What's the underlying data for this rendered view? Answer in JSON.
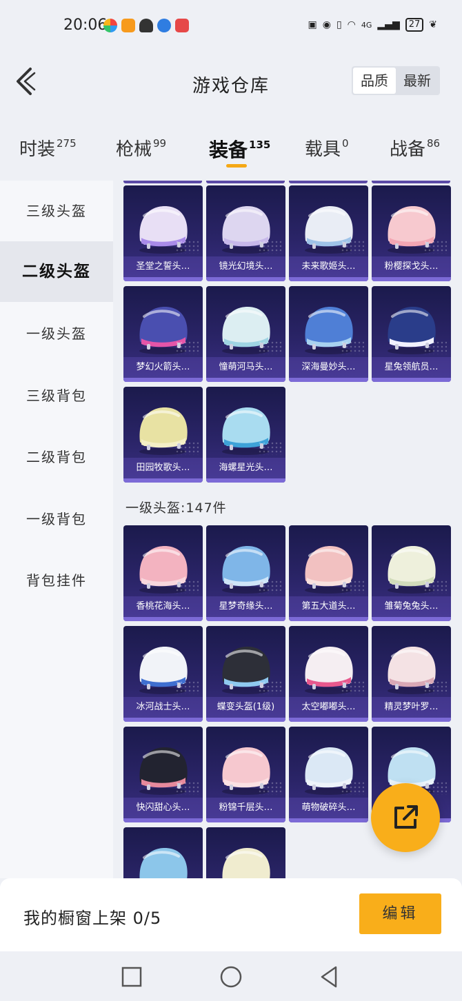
{
  "status_bar": {
    "time": "20:06",
    "network": "4G",
    "battery": "27"
  },
  "header": {
    "title": "游戏仓库",
    "sort_options": [
      "品质",
      "最新"
    ],
    "active_sort": "品质"
  },
  "tabs": [
    {
      "label": "时装",
      "count": "275"
    },
    {
      "label": "枪械",
      "count": "99"
    },
    {
      "label": "装备",
      "count": "135",
      "active": true
    },
    {
      "label": "载具",
      "count": "0"
    },
    {
      "label": "战备",
      "count": "86"
    }
  ],
  "sidebar": {
    "items": [
      "三级头盔",
      "二级头盔",
      "一级头盔",
      "三级背包",
      "二级背包",
      "一级背包",
      "背包挂件"
    ],
    "active": "二级头盔"
  },
  "level2_items": [
    {
      "name": "圣堂之誓头…",
      "color": "#e8dff5",
      "accent": "#a98be8"
    },
    {
      "name": "镜光幻境头…",
      "color": "#ddd6f0",
      "accent": "#c7b8ea"
    },
    {
      "name": "未来歌姬头…",
      "color": "#e9edf5",
      "accent": "#9fc3e8"
    },
    {
      "name": "粉樱探戈头…",
      "color": "#f7c9cf",
      "accent": "#f3a6b3"
    },
    {
      "name": "梦幻火箭头…",
      "color": "#4a4fb0",
      "accent": "#e455a8"
    },
    {
      "name": "憧萌河马头…",
      "color": "#dceef2",
      "accent": "#9fd4e3"
    },
    {
      "name": "深海曼妙头…",
      "color": "#4f7fd6",
      "accent": "#a9d2f0"
    },
    {
      "name": "星兔领航员…",
      "color": "#2a3d8a",
      "accent": "#f1f1ff"
    },
    {
      "name": "田园牧歌头…",
      "color": "#e8e2a3",
      "accent": "#f4efc6"
    },
    {
      "name": "海螺星光头…",
      "color": "#a9dcf0",
      "accent": "#3ea2d8"
    }
  ],
  "level1_section": {
    "title": "一级头盔:147件"
  },
  "level1_items": [
    {
      "name": "香桃花海头…",
      "color": "#f3b3c0",
      "accent": "#f8d7dd"
    },
    {
      "name": "星梦奇缘头…",
      "color": "#7fb6e8",
      "accent": "#cfe5f7"
    },
    {
      "name": "第五大道头…",
      "color": "#f2c1c1",
      "accent": "#f8e1de"
    },
    {
      "name": "雏菊兔兔头…",
      "color": "#eef0dc",
      "accent": "#d2dcbb"
    },
    {
      "name": "冰河战士头…",
      "color": "#f1f3f8",
      "accent": "#3f6fd0"
    },
    {
      "name": "蝶变头盔(1级)",
      "color": "#2d2f38",
      "accent": "#8fc9ef"
    },
    {
      "name": "太空嘟嘟头…",
      "color": "#f5eef2",
      "accent": "#e7588d"
    },
    {
      "name": "精灵梦叶罗…",
      "color": "#f4e2e4",
      "accent": "#d9a8b5"
    },
    {
      "name": "快闪甜心头…",
      "color": "#222330",
      "accent": "#e6899c"
    },
    {
      "name": "粉锦千层头…",
      "color": "#f6c8cf",
      "accent": "#fbe1e4"
    },
    {
      "name": "萌物破碎头…",
      "color": "#dbe8f5",
      "accent": "#eef4fa"
    },
    {
      "name": "",
      "color": "#bfe0f2",
      "accent": "#ebf4fa"
    },
    {
      "name": "",
      "color": "#8cc6ea",
      "accent": "#f0f6fb"
    },
    {
      "name": "",
      "color": "#f0eccf",
      "accent": "#f8f5e3"
    }
  ],
  "bottom_bar": {
    "text": "我的橱窗上架 0/5",
    "edit_label": "编辑"
  }
}
